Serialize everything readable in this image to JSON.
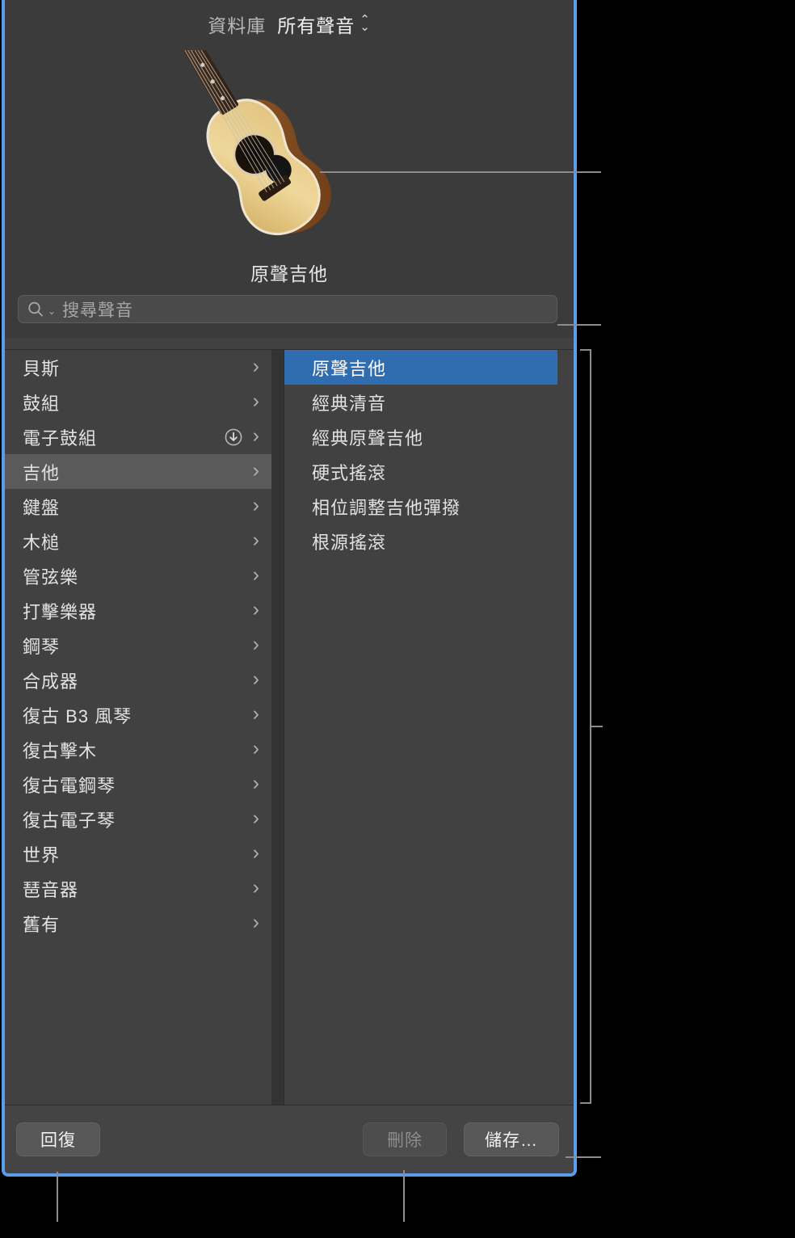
{
  "window": {
    "accent_border_color": "#5a9ded",
    "panel_bg": "#414141",
    "selection_blue": "#2f6cb0"
  },
  "header": {
    "library_label": "資料庫",
    "menu_label": "所有聲音",
    "stepper_up": "⌃",
    "stepper_down": "⌄"
  },
  "preview": {
    "patch_name": "原聲吉他",
    "image_icon": "acoustic-guitar-illustration"
  },
  "search": {
    "placeholder": "搜尋聲音",
    "value": "",
    "icon": "search-icon",
    "chevron": "⌄"
  },
  "categories": {
    "chevron": "›",
    "download_icon": "download-circle-icon",
    "selected_index": 3,
    "items": [
      {
        "label": "貝斯",
        "download": false
      },
      {
        "label": "鼓組",
        "download": false
      },
      {
        "label": "電子鼓組",
        "download": true
      },
      {
        "label": "吉他",
        "download": false
      },
      {
        "label": "鍵盤",
        "download": false
      },
      {
        "label": "木槌",
        "download": false
      },
      {
        "label": "管弦樂",
        "download": false
      },
      {
        "label": "打擊樂器",
        "download": false
      },
      {
        "label": "鋼琴",
        "download": false
      },
      {
        "label": "合成器",
        "download": false
      },
      {
        "label": "復古 B3 風琴",
        "download": false
      },
      {
        "label": "復古擊木",
        "download": false
      },
      {
        "label": "復古電鋼琴",
        "download": false
      },
      {
        "label": "復古電子琴",
        "download": false
      },
      {
        "label": "世界",
        "download": false
      },
      {
        "label": "琶音器",
        "download": false
      },
      {
        "label": "舊有",
        "download": false
      }
    ]
  },
  "patches": {
    "selected_index": 0,
    "items": [
      {
        "label": "原聲吉他"
      },
      {
        "label": "經典清音"
      },
      {
        "label": "經典原聲吉他"
      },
      {
        "label": "硬式搖滾"
      },
      {
        "label": "相位調整吉他彈撥"
      },
      {
        "label": "根源搖滾"
      }
    ]
  },
  "buttons": {
    "revert": "回復",
    "delete": "刪除",
    "save": "儲存…"
  }
}
